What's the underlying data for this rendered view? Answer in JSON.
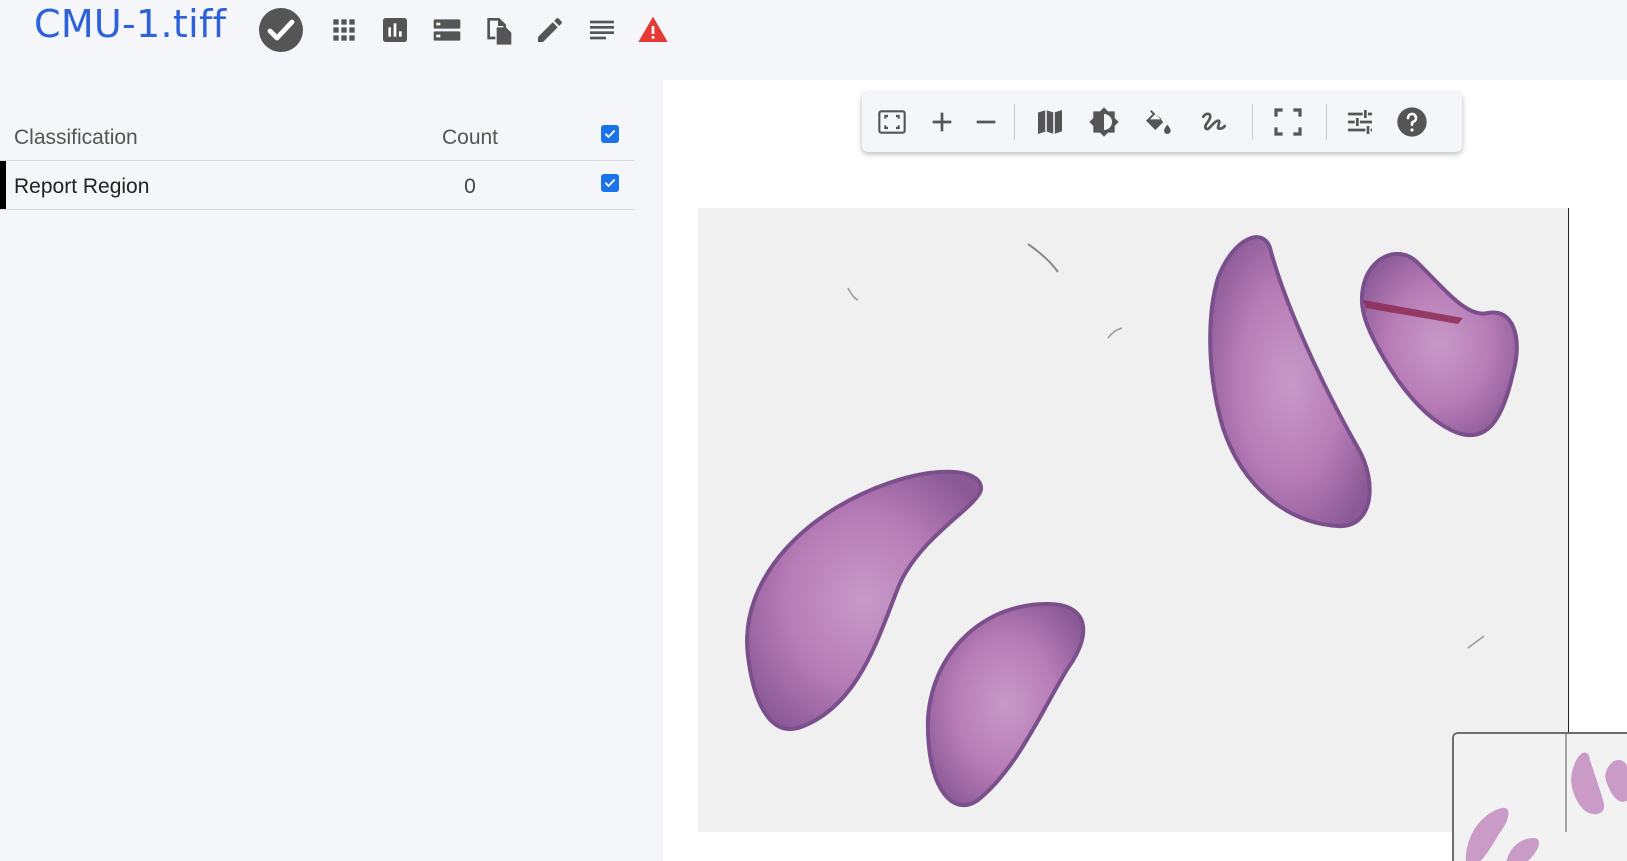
{
  "header": {
    "title": "CMU-1.tiff",
    "icons": [
      "check-circle-icon",
      "grid-icon",
      "bar-chart-icon",
      "storage-icon",
      "copy-icon",
      "pencil-icon",
      "notes-icon",
      "warning-icon"
    ],
    "warning_color": "#e53935",
    "accent_color": "#2f62d8"
  },
  "table": {
    "headers": {
      "classification": "Classification",
      "count": "Count"
    },
    "rows": [
      {
        "classification": "Report Region",
        "count": "0",
        "checked": true,
        "color": "#000000"
      }
    ]
  },
  "viewer": {
    "toolbar": [
      "fit-to-screen-icon",
      "zoom-in-icon",
      "zoom-out-icon",
      "map-icon",
      "brightness-icon",
      "fill-color-icon",
      "draw-icon",
      "fullscreen-icon",
      "adjust-icon",
      "help-icon"
    ]
  }
}
